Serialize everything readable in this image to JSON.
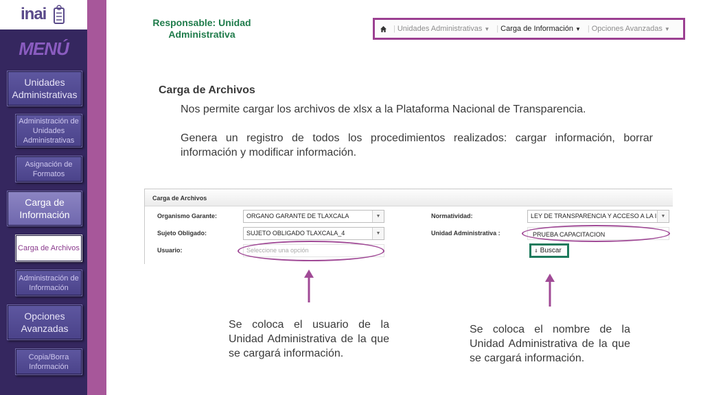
{
  "logo": {
    "text": "inai"
  },
  "sidebar": {
    "menu_title": "MENÚ",
    "items": [
      {
        "label": "Unidades Administrativas"
      },
      {
        "label": "Administración de Unidades Administrativas"
      },
      {
        "label": "Asignación de Formatos"
      },
      {
        "label": "Carga de Información"
      },
      {
        "label": "Carga de Archivos"
      },
      {
        "label": "Administración de Información"
      },
      {
        "label": "Opciones Avanzadas"
      },
      {
        "label": "Copia/Borra Información"
      }
    ]
  },
  "header": {
    "responsable": "Responsable: Unidad Administrativa",
    "nav": [
      {
        "label": "Unidades Administrativas"
      },
      {
        "label": "Carga de Información"
      },
      {
        "label": "Opciones Avanzadas"
      }
    ]
  },
  "content": {
    "section_title": "Carga de Archivos",
    "para1": "Nos permite cargar los archivos de xlsx a la Plataforma Nacional de Transparencia.",
    "para2": "Genera un registro de todos los procedimientos realizados: cargar información, borrar información y modificar información."
  },
  "form": {
    "title": "Carga de Archivos",
    "organismo_label": "Organismo Garante:",
    "organismo_value": "ORGANO GARANTE DE TLAXCALA",
    "sujeto_label": "Sujeto Obligado:",
    "sujeto_value": "SUJETO OBLIGADO TLAXCALA_4",
    "usuario_label": "Usuario:",
    "usuario_placeholder": "Seleccione una opción",
    "normatividad_label": "Normatividad:",
    "normatividad_value": "LEY DE TRANSPARENCIA Y ACCESO A LA IN",
    "unidad_label": "Unidad Administrativa :",
    "unidad_value": "PRUEBA CAPACITACION",
    "buscar_label": "Buscar"
  },
  "captions": {
    "left": "Se coloca el usuario de la Unidad Administrativa de la que se cargará información.",
    "right": "Se coloca el nombre de la Unidad Administrativa de la que se cargará información."
  },
  "colors": {
    "sidebar_bg": "#35275f",
    "accent_purple": "#a7579a",
    "highlight_green": "#1d7a5c",
    "responsable_text": "#1e7b4a"
  }
}
